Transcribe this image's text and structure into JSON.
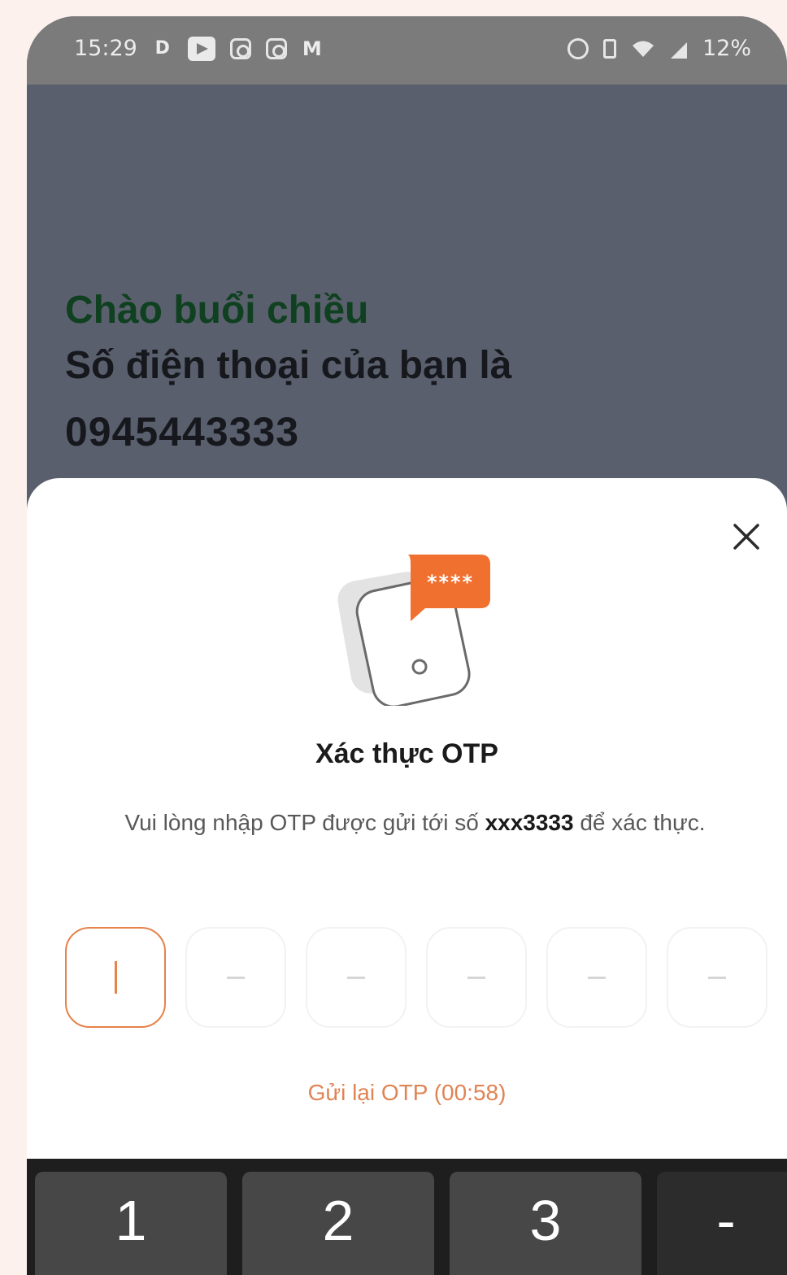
{
  "status_bar": {
    "time": "15:29",
    "battery": "12%",
    "left_icons": [
      "d-app-icon",
      "youtube-tv-icon",
      "instagram-icon",
      "instagram-icon",
      "gmail-icon"
    ],
    "right_icons": [
      "alarm-icon",
      "vibrate-icon",
      "wifi-icon",
      "signal-icon"
    ]
  },
  "greeting": {
    "title": "Chào buổi chiều",
    "line": "Số điện thoại của bạn là",
    "phone": "0945443333"
  },
  "otp_sheet": {
    "title": "Xác thực OTP",
    "desc_before": "Vui lòng nhập OTP được gửi tới số ",
    "desc_number": "xxx3333",
    "desc_after": " để xác thực.",
    "otp_boxes": 6,
    "resend": "Gửi lại OTP (00:58)",
    "badge_text": "****"
  },
  "keypad": {
    "keys": [
      "1",
      "2",
      "3",
      "-"
    ]
  },
  "colors": {
    "accent": "#f07030",
    "greeting_green": "#0f4020",
    "resend": "#e08455"
  }
}
